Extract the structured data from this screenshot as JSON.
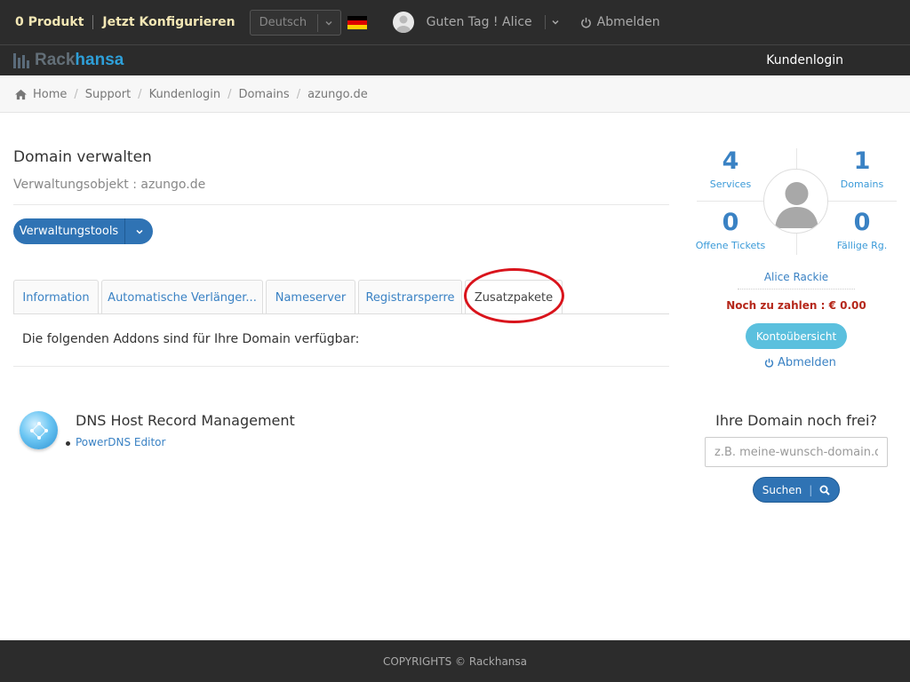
{
  "topbar": {
    "cart": "0 Produkt",
    "configure": "Jetzt Konfigurieren",
    "language": "Deutsch",
    "greeting": "Guten Tag ! Alice",
    "logout": "Abmelden",
    "flag_colors": [
      "#000000",
      "#dd0000",
      "#ffce00"
    ]
  },
  "navbar": {
    "logo_part1": "Rack",
    "logo_part2": "hansa",
    "login": "Kundenlogin"
  },
  "breadcrumb": [
    "Home",
    "Support",
    "Kundenlogin",
    "Domains",
    "azungo.de"
  ],
  "main": {
    "title": "Domain verwalten",
    "subtitle": "Verwaltungsobjekt : azungo.de",
    "tools_button": "Verwaltungstools",
    "tabs": [
      "Information",
      "Automatische Verlänger...",
      "Nameserver",
      "Registrarsperre",
      "Zusatzpakete"
    ],
    "active_tab": "Zusatzpakete",
    "addon_intro": "Die folgenden Addons sind für Ihre Domain verfügbar:",
    "addon_title": "DNS Host Record Management",
    "addon_link": "PowerDNS Editor"
  },
  "sidebar": {
    "stats": [
      {
        "value": "4",
        "label": "Services"
      },
      {
        "value": "1",
        "label": "Domains"
      },
      {
        "value": "0",
        "label": "Offene Tickets"
      },
      {
        "value": "0",
        "label": "Fällige Rg."
      }
    ],
    "user_name": "Alice Rackie",
    "due": "Noch zu zahlen : € 0.00",
    "account_button": "Kontoübersicht",
    "logout": "Abmelden",
    "domain_question": "Ihre Domain noch frei?",
    "domain_placeholder": "z.B. meine-wunsch-domain.de",
    "search_button": "Suchen"
  },
  "footer": {
    "copyright": "COPYRIGHTS © Rackhansa"
  },
  "colors": {
    "accent": "#2f73b4",
    "link": "#3a82c4",
    "annotation": "#d9141c"
  }
}
